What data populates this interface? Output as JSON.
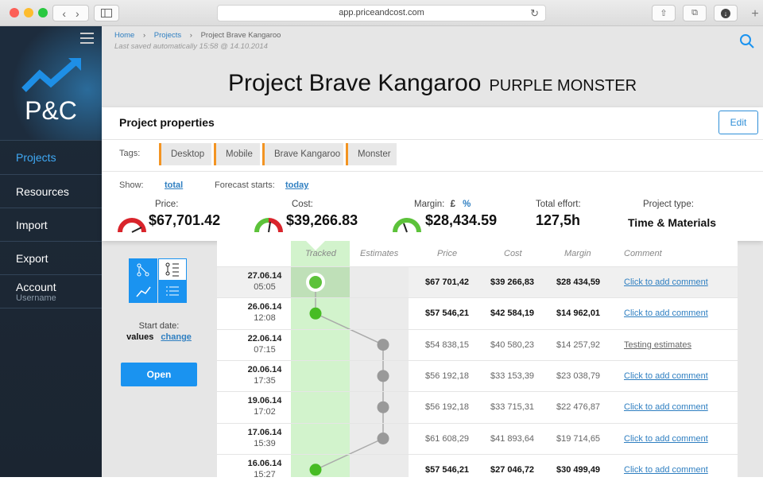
{
  "browser": {
    "url": "app.priceandcost.com"
  },
  "sidebar": {
    "logo_text": "P&C",
    "items": [
      {
        "label": "Projects",
        "sub": ""
      },
      {
        "label": "Resources",
        "sub": ""
      },
      {
        "label": "Import",
        "sub": ""
      },
      {
        "label": "Export",
        "sub": ""
      },
      {
        "label": "Account",
        "sub": "Username"
      }
    ],
    "active_color": "#3fa9f5"
  },
  "breadcrumb": {
    "home": "Home",
    "projects": "Projects",
    "current": "Project Brave Kangaroo"
  },
  "saved_text": "Last saved automatically 15:58 @ 14.10.2014",
  "title": {
    "main": "Project Brave Kangaroo",
    "sub": "PURPLE MONSTER"
  },
  "properties": {
    "heading": "Project properties",
    "edit_label": "Edit",
    "tags_label": "Tags:",
    "tags": [
      "Desktop",
      "Mobile",
      "Brave Kangaroo",
      "Monster"
    ],
    "show_label": "Show:",
    "show_value": "total",
    "forecast_label": "Forecast starts:",
    "forecast_value": "today",
    "price_label": "Price:",
    "price_value": "$67,701.42",
    "cost_label": "Cost:",
    "cost_value": "$39,266.83",
    "margin_label": "Margin:",
    "margin_pound": "£",
    "margin_percent": "%",
    "margin_value": "$28,434.59",
    "effort_label": "Total effort:",
    "effort_value": "127,5h",
    "type_label": "Project type:",
    "type_value": "Time & Materials"
  },
  "left": {
    "start_label": "Start date:",
    "start_value": "values",
    "change": "change",
    "open_label": "Open"
  },
  "table": {
    "headers": {
      "tracked": "Tracked",
      "estimates": "Estimates",
      "price": "Price",
      "cost": "Cost",
      "margin": "Margin",
      "comment": "Comment"
    },
    "rows": [
      {
        "date": "27.06.14",
        "time": "05:05",
        "price": "$67 701,42",
        "cost": "$39 266,83",
        "margin": "$28 434,59",
        "comment": "Click to add comment",
        "bold": true,
        "link": true
      },
      {
        "date": "26.06.14",
        "time": "12:08",
        "price": "$57 546,21",
        "cost": "$42 584,19",
        "margin": "$14 962,01",
        "comment": "Click to add comment",
        "bold": true,
        "link": true
      },
      {
        "date": "22.06.14",
        "time": "07:15",
        "price": "$54 838,15",
        "cost": "$40 580,23",
        "margin": "$14 257,92",
        "comment": "Testing estimates",
        "bold": false,
        "link": false
      },
      {
        "date": "20.06.14",
        "time": "17:35",
        "price": "$56 192,18",
        "cost": "$33 153,39",
        "margin": "$23 038,79",
        "comment": "Click to add comment",
        "bold": false,
        "link": true
      },
      {
        "date": "19.06.14",
        "time": "17:02",
        "price": "$56 192,18",
        "cost": "$33 715,31",
        "margin": "$22 476,87",
        "comment": "Click to add comment",
        "bold": false,
        "link": true
      },
      {
        "date": "17.06.14",
        "time": "15:39",
        "price": "$61 608,29",
        "cost": "$41 893,64",
        "margin": "$19 714,65",
        "comment": "Click to add comment",
        "bold": false,
        "link": true
      },
      {
        "date": "16.06.14",
        "time": "15:27",
        "price": "$57 546,21",
        "cost": "$27 046,72",
        "margin": "$30 499,49",
        "comment": "Click to add comment",
        "bold": true,
        "link": true
      }
    ],
    "nodes": [
      "tracked",
      "tracked",
      "estimate",
      "estimate",
      "estimate",
      "estimate",
      "tracked"
    ]
  }
}
